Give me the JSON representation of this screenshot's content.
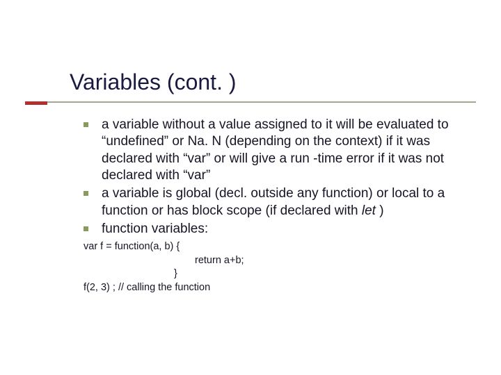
{
  "title": "Variables (cont. )",
  "bullets": [
    {
      "text": "a variable without a value assigned to it will be evaluated to “undefined” or Na. N (depending on the context) if it was declared with “var” or will give a run -time error if it was not declared with “var”"
    },
    {
      "text_pre": "a variable is global (decl. outside any function) or local to a function or has block scope (if declared with ",
      "italic": "let",
      "text_post": " )"
    },
    {
      "text": "function variables:"
    }
  ],
  "code": {
    "line1": "var f = function(a, b) {",
    "line2": "return a+b;",
    "line3": "}",
    "line4": "f(2, 3) ; // calling the function"
  }
}
